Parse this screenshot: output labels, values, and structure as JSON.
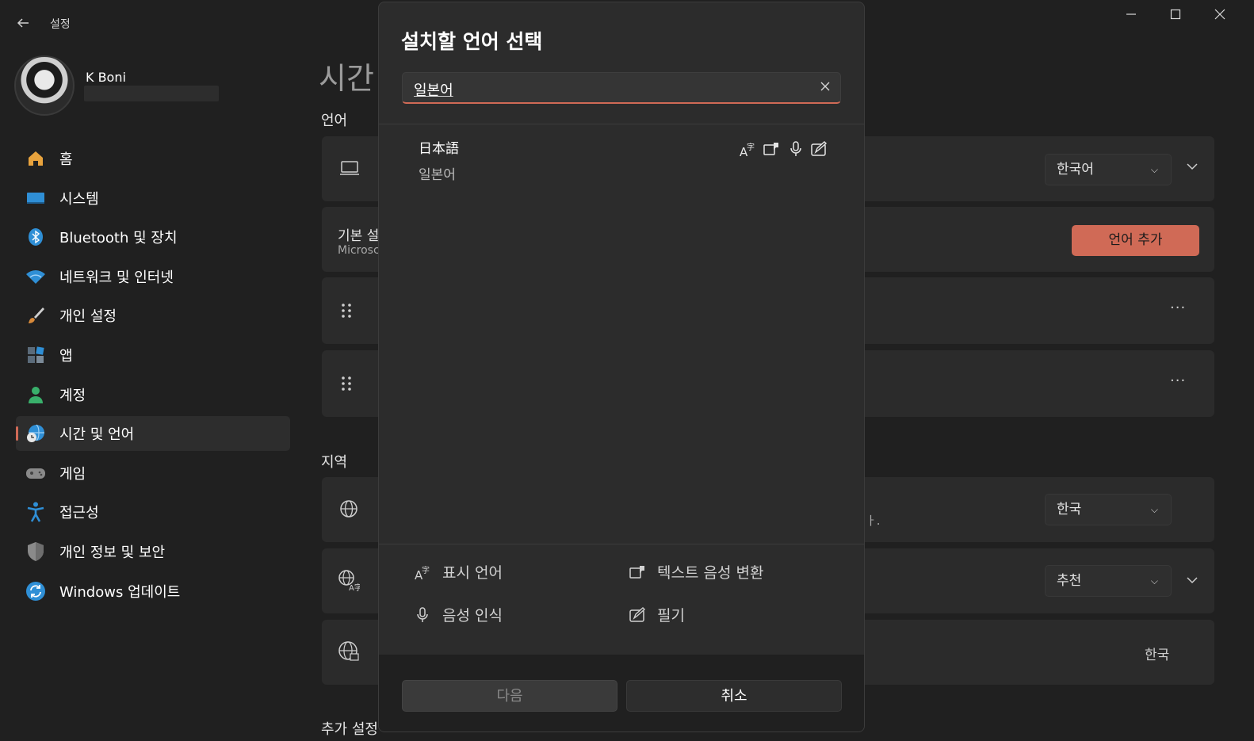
{
  "window": {
    "title": "설정",
    "back_icon": "back-arrow-icon"
  },
  "profile": {
    "name": "K Boni"
  },
  "nav": {
    "items": [
      {
        "label": "홈",
        "icon": "home-icon",
        "color": "#e8a33d"
      },
      {
        "label": "시스템",
        "icon": "system-icon",
        "color": "#2f8fd6"
      },
      {
        "label": "Bluetooth 및 장치",
        "icon": "bluetooth-icon",
        "color": "#2f8fd6"
      },
      {
        "label": "네트워크 및 인터넷",
        "icon": "wifi-icon",
        "color": "#2f8fd6"
      },
      {
        "label": "개인 설정",
        "icon": "brush-icon",
        "color": "#d88a3a"
      },
      {
        "label": "앱",
        "icon": "apps-icon",
        "color": "#6b7c8c"
      },
      {
        "label": "계정",
        "icon": "account-icon",
        "color": "#39b06b"
      },
      {
        "label": "시간 및 언어",
        "icon": "time-language-icon",
        "color": "#2f8fd6"
      },
      {
        "label": "게임",
        "icon": "gaming-icon",
        "color": "#8a8a8a"
      },
      {
        "label": "접근성",
        "icon": "accessibility-icon",
        "color": "#2f8fd6"
      },
      {
        "label": "개인 정보 및 보안",
        "icon": "shield-icon",
        "color": "#8a8a8a"
      },
      {
        "label": "Windows 업데이트",
        "icon": "update-icon",
        "color": "#2f8fd6"
      }
    ],
    "active_index": 7
  },
  "page": {
    "title": "시간",
    "section_language": "언어",
    "section_region": "지역",
    "section_more": "추가 설정",
    "display_lang_value": "한국어",
    "pref_title": "기본 설",
    "pref_sub": "Microsc",
    "add_language_button": "언어 추가",
    "region_value": "한국",
    "region_hint": "ㅏ.",
    "format_value": "추천",
    "regional_format_value": "한국",
    "more_dots": "···"
  },
  "dialog": {
    "title": "설치할 언어 선택",
    "search_value": "일본어",
    "result": {
      "native": "日本語",
      "name": "일본어"
    },
    "legend": [
      {
        "label": "표시 언어",
        "icon": "display-language-icon"
      },
      {
        "label": "텍스트 음성 변환",
        "icon": "text-to-speech-icon"
      },
      {
        "label": "음성 인식",
        "icon": "speech-recognition-icon"
      },
      {
        "label": "필기",
        "icon": "handwriting-icon"
      }
    ],
    "buttons": {
      "next": "다음",
      "cancel": "취소"
    }
  },
  "colors": {
    "accent": "#d06a56",
    "background": "#202020",
    "card": "#2b2b2b"
  }
}
